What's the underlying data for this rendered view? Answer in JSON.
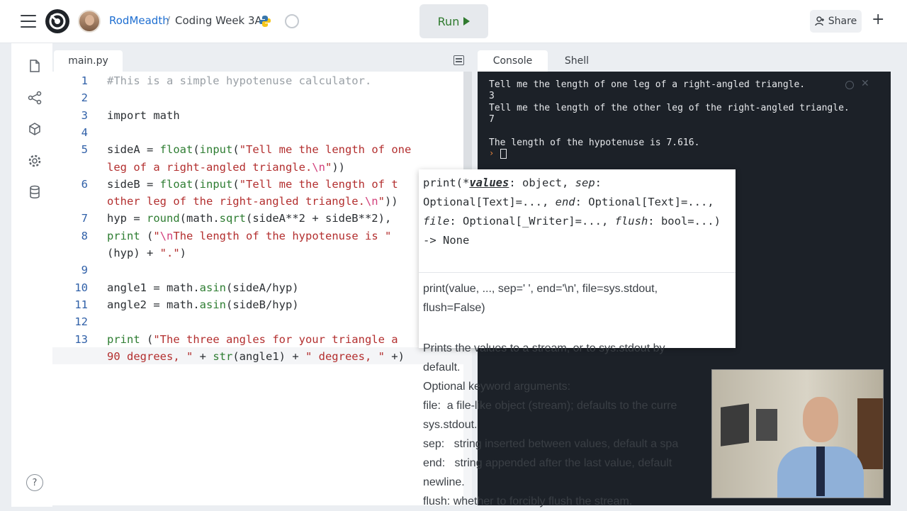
{
  "header": {
    "user": "RodMeadth",
    "separator": "/",
    "project": "Coding Week 3A",
    "run_label": "Run",
    "share_label": "Share",
    "plus": "+"
  },
  "editor": {
    "file_tab": "main.py",
    "lines": [
      {
        "n": "1",
        "html": "<span class='cm'>#This is a simple hypotenuse calculator.</span>"
      },
      {
        "n": "2",
        "html": ""
      },
      {
        "n": "3",
        "html": "import math"
      },
      {
        "n": "4",
        "html": ""
      },
      {
        "n": "5",
        "html": "sideA = <span class='fn'>float</span>(<span class='fn'>input</span>(<span class='st'>\"Tell me the length of one</span>"
      },
      {
        "n": "",
        "html": "<span class='st'>leg of a right-angled triangle.</span><span class='esc'>\\n</span><span class='st'>\"</span>))"
      },
      {
        "n": "6",
        "html": "sideB = <span class='fn'>float</span>(<span class='fn'>input</span>(<span class='st'>\"Tell me the length of t</span>"
      },
      {
        "n": "",
        "html": "<span class='st'>other leg of the right-angled triangle.</span><span class='esc'>\\n</span><span class='st'>\"</span>))"
      },
      {
        "n": "7",
        "html": "hyp = <span class='fn'>round</span>(math.<span class='fn'>sqrt</span>(sideA**2 + sideB**2),"
      },
      {
        "n": "8",
        "html": "<span class='fn'>print</span> (<span class='st'>\"</span><span class='esc'>\\n</span><span class='st'>The length of the hypotenuse is \"</span>"
      },
      {
        "n": "",
        "html": "(hyp) + <span class='st'>\".\"</span>)"
      },
      {
        "n": "9",
        "html": ""
      },
      {
        "n": "10",
        "html": "angle1 = math.<span class='fn'>asin</span>(sideA/hyp)"
      },
      {
        "n": "11",
        "html": "angle2 = math.<span class='fn'>asin</span>(sideB/hyp)"
      },
      {
        "n": "12",
        "html": ""
      },
      {
        "n": "13",
        "html": "<span class='fn'>print</span> (<span class='st'>\"The three angles for your triangle a</span>"
      },
      {
        "n": "",
        "html": "<span class='st'>90 degrees, \"</span> + <span class='fn'>str</span>(angle1) + <span class='st'>\" degrees, \"</span> +)"
      }
    ]
  },
  "console": {
    "tab_console": "Console",
    "tab_shell": "Shell",
    "output": [
      "Tell me the length of one leg of a right-angled triangle.",
      "3",
      "Tell me the length of the other leg of the right-angled triangle.",
      "7",
      "",
      "The length of the hypotenuse is 7.616."
    ],
    "prompt": "›"
  },
  "tooltip": {
    "signature_html": "print(*<span class='hl'>values</span>: object, <span class='it'>sep</span>: Optional[Text]=..., <span class='it'>end</span>: Optional[Text]=..., <span class='it'>file</span>: Optional[_Writer]=..., <span class='it'>flush</span>: bool=...) -> None",
    "doc_signature": "print(value, ..., sep=' ', end='\\n', file=sys.stdout, flush=False)",
    "doc_lines": [
      "Prints the values to a stream, or to sys.stdout by",
      "default.",
      "Optional keyword arguments:",
      "file:  a file-like object (stream); defaults to the curre",
      "sys.stdout.",
      "sep:   string inserted between values, default a spa",
      "end:   string appended after the last value, default",
      "newline.",
      "flush: whether to forcibly flush the stream."
    ]
  },
  "sidebar": {
    "help": "?"
  }
}
